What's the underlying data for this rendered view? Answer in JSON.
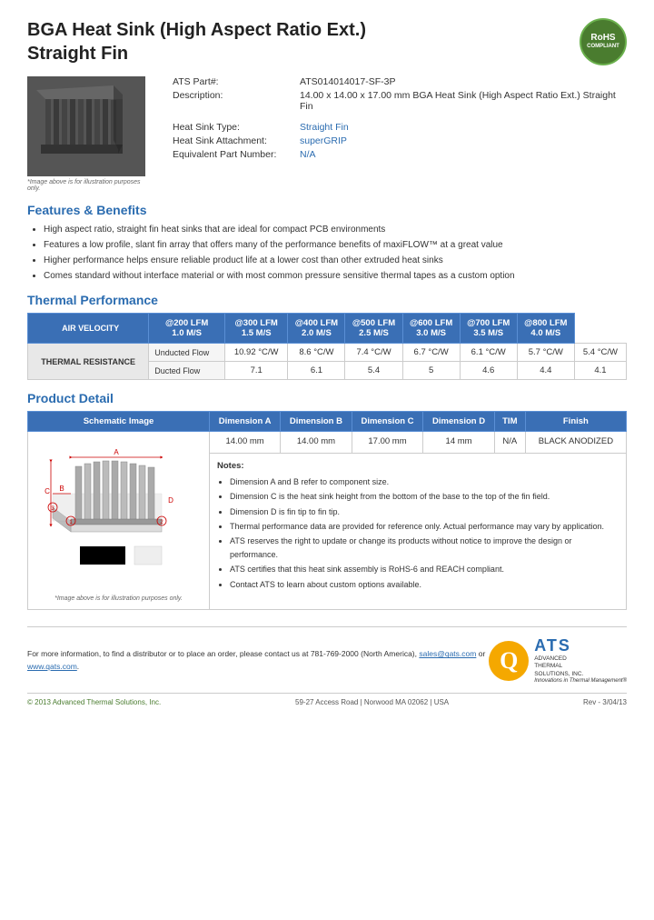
{
  "header": {
    "title_line1": "BGA Heat Sink (High Aspect Ratio Ext.)",
    "title_line2": "Straight Fin",
    "rohs_line1": "RoHS",
    "rohs_line2": "COMPLIANT"
  },
  "product": {
    "part_label": "ATS Part#:",
    "part_number": "ATS014014017-SF-3P",
    "desc_label": "Description:",
    "description": "14.00 x 14.00 x 17.00 mm BGA Heat Sink (High Aspect Ratio Ext.) Straight Fin",
    "type_label": "Heat Sink Type:",
    "type_value": "Straight Fin",
    "attachment_label": "Heat Sink Attachment:",
    "attachment_value": "superGRIP",
    "equiv_label": "Equivalent Part Number:",
    "equiv_value": "N/A",
    "image_caption": "*Image above is for illustration purposes only."
  },
  "features": {
    "section_title": "Features & Benefits",
    "items": [
      "High aspect ratio, straight fin heat sinks that are ideal for compact PCB environments",
      "Features a low profile, slant fin array that offers many of the performance benefits of maxiFLOW™ at a great value",
      "Higher performance helps ensure reliable product life at a lower cost than other extruded heat sinks",
      "Comes standard without interface material or with most common pressure sensitive thermal tapes as a custom option"
    ]
  },
  "thermal": {
    "section_title": "Thermal Performance",
    "col_header": "AIR VELOCITY",
    "columns": [
      "@200 LFM\n1.0 M/S",
      "@300 LFM\n1.5 M/S",
      "@400 LFM\n2.0 M/S",
      "@500 LFM\n2.5 M/S",
      "@600 LFM\n3.0 M/S",
      "@700 LFM\n3.5 M/S",
      "@800 LFM\n4.0 M/S"
    ],
    "col_headers_line1": [
      "@200 LFM",
      "@300 LFM",
      "@400 LFM",
      "@500 LFM",
      "@600 LFM",
      "@700 LFM",
      "@800 LFM"
    ],
    "col_headers_line2": [
      "1.0 M/S",
      "1.5 M/S",
      "2.0 M/S",
      "2.5 M/S",
      "3.0 M/S",
      "3.5 M/S",
      "4.0 M/S"
    ],
    "row_label": "THERMAL RESISTANCE",
    "row1_label": "Unducted Flow",
    "row1_values": [
      "10.92 °C/W",
      "8.6 °C/W",
      "7.4 °C/W",
      "6.7 °C/W",
      "6.1 °C/W",
      "5.7 °C/W",
      "5.4 °C/W"
    ],
    "row2_label": "Ducted Flow",
    "row2_values": [
      "7.1",
      "6.1",
      "5.4",
      "5",
      "4.6",
      "4.4",
      "4.1"
    ]
  },
  "product_detail": {
    "section_title": "Product Detail",
    "table_headers": [
      "Schematic Image",
      "Dimension A",
      "Dimension B",
      "Dimension C",
      "Dimension D",
      "TIM",
      "Finish"
    ],
    "dim_a": "14.00 mm",
    "dim_b": "14.00 mm",
    "dim_c": "17.00 mm",
    "dim_d": "14 mm",
    "tim": "N/A",
    "finish": "BLACK ANODIZED",
    "schematic_caption": "*Image above is for illustration purposes only.",
    "notes_title": "Notes:",
    "notes": [
      "Dimension A and B refer to component size.",
      "Dimension C is the heat sink height from the bottom of the base to the top of the fin field.",
      "Dimension D is fin tip to fin tip.",
      "Thermal performance data are provided for reference only. Actual performance may vary by application.",
      "ATS reserves the right to update or change its products without notice to improve the design or performance.",
      "ATS certifies that this heat sink assembly is RoHS-6 and REACH compliant.",
      "Contact ATS to learn about custom options available."
    ]
  },
  "footer": {
    "contact_text": "For more information, to find a distributor or to place an order, please contact us at 781-769-2000 (North America),",
    "email": "sales@qats.com",
    "or_text": "or",
    "website": "www.qats.com",
    "period": ".",
    "ats_q": "Q",
    "ats_big": "ATS",
    "ats_name_line1": "ADVANCED",
    "ats_name_line2": "THERMAL",
    "ats_name_line3": "SOLUTIONS, INC.",
    "ats_tagline": "Innovations in Thermal Management®",
    "copyright": "© 2013 Advanced Thermal Solutions, Inc.",
    "address": "59-27 Access Road  |  Norwood MA  02062  |  USA",
    "rev": "Rev - 3/04/13"
  }
}
